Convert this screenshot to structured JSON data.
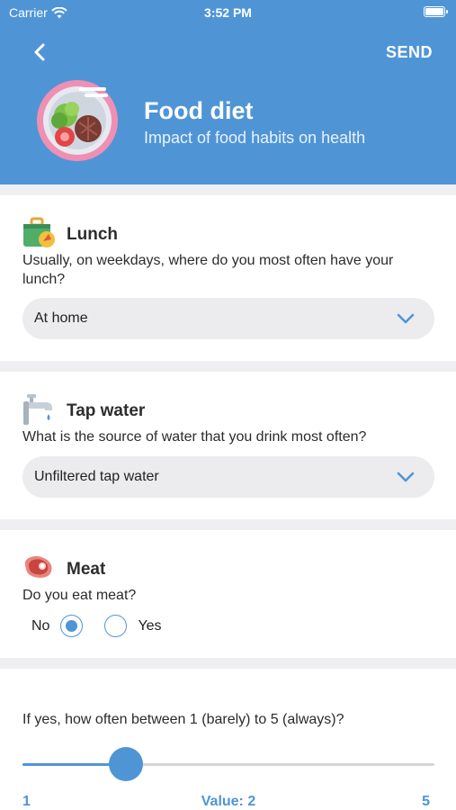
{
  "status_bar": {
    "carrier": "Carrier",
    "time": "3:52 PM",
    "battery_level": 1.0
  },
  "nav": {
    "send_label": "SEND",
    "back_icon": "chevron-left-icon"
  },
  "header": {
    "title": "Food diet",
    "subtitle": "Impact of food habits on health",
    "logo_icon": "food-plate-icon"
  },
  "questions": {
    "lunch": {
      "title": "Lunch",
      "question": "Usually, on weekdays, where do you most often have your lunch?",
      "selected": "At home",
      "icon": "lunchbox-icon"
    },
    "tap_water": {
      "title": "Tap water",
      "question": "What is the source of water that you drink most often?",
      "selected": "Unfiltered tap water",
      "icon": "faucet-icon"
    },
    "meat": {
      "title": "Meat",
      "question": "Do you eat meat?",
      "options": [
        "No",
        "Yes"
      ],
      "selected": "No",
      "icon": "steak-icon"
    },
    "frequency": {
      "question": "If yes, how often between 1 (barely) to 5 (always)?",
      "min_label": "1",
      "max_label": "5",
      "value_label": "Value: 2",
      "min": 1,
      "max": 5,
      "value": 2
    }
  },
  "colors": {
    "accent": "#4f95d6",
    "background": "#efeff1",
    "card": "#ffffff"
  }
}
